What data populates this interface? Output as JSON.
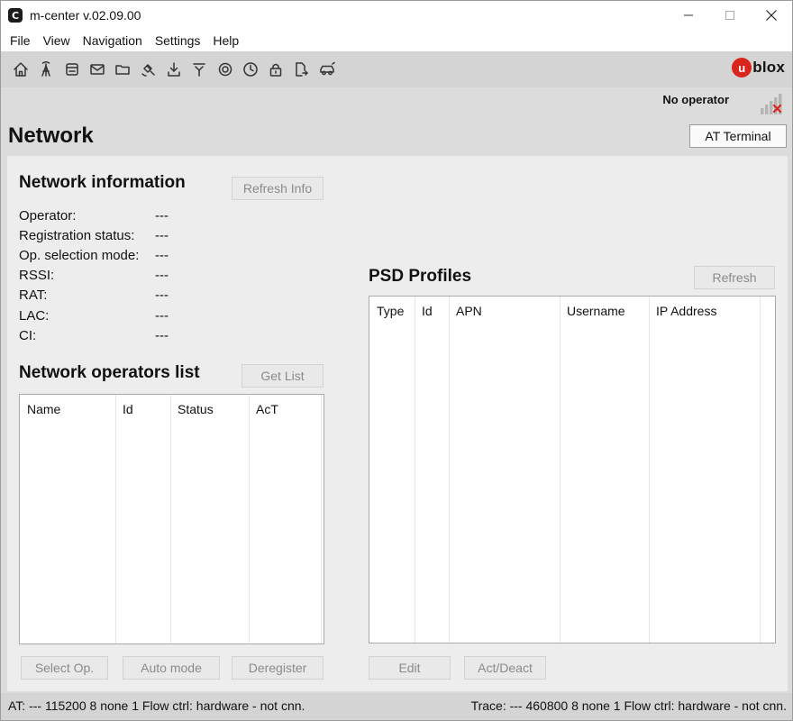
{
  "window": {
    "app_icon_letter": "C",
    "title": "m-center v.02.09.00"
  },
  "menu": [
    "File",
    "View",
    "Navigation",
    "Settings",
    "Help"
  ],
  "toolbar": {
    "icons": [
      "home-icon",
      "antenna-icon",
      "sim-card-icon",
      "mail-icon",
      "folder-icon",
      "satellite-icon",
      "download-icon",
      "upload-icon",
      "settings-icon",
      "clock-icon",
      "lock-icon",
      "file-export-icon",
      "car-icon"
    ]
  },
  "brand": {
    "logo_letter": "u",
    "logo_text": "blox",
    "logo_color": "#d9251c"
  },
  "operator_status": "No operator",
  "page": {
    "title": "Network",
    "at_terminal_label": "AT Terminal"
  },
  "network_info": {
    "title": "Network information",
    "refresh_label": "Refresh Info",
    "rows": [
      {
        "label": "Operator:",
        "value": "---"
      },
      {
        "label": "Registration status:",
        "value": "---"
      },
      {
        "label": "Op. selection mode:",
        "value": "---"
      },
      {
        "label": "RSSI:",
        "value": "---"
      },
      {
        "label": "RAT:",
        "value": "---"
      },
      {
        "label": "LAC:",
        "value": "---"
      },
      {
        "label": "CI:",
        "value": "---"
      }
    ]
  },
  "operators_list": {
    "title": "Network operators list",
    "get_list_label": "Get List",
    "columns": [
      "Name",
      "Id",
      "Status",
      "AcT"
    ],
    "rows": [],
    "buttons": {
      "select": "Select Op.",
      "auto": "Auto mode",
      "deregister": "Deregister"
    }
  },
  "psd_profiles": {
    "title": "PSD Profiles",
    "refresh_label": "Refresh",
    "columns": [
      "Type",
      "Id",
      "APN",
      "Username",
      "IP Address"
    ],
    "rows": [],
    "buttons": {
      "edit": "Edit",
      "act_deact": "Act/Deact"
    }
  },
  "status": {
    "at": "AT: --- 115200 8 none 1 Flow ctrl: hardware - not cnn.",
    "trace": "Trace: --- 460800 8 none 1 Flow ctrl: hardware - not cnn."
  }
}
